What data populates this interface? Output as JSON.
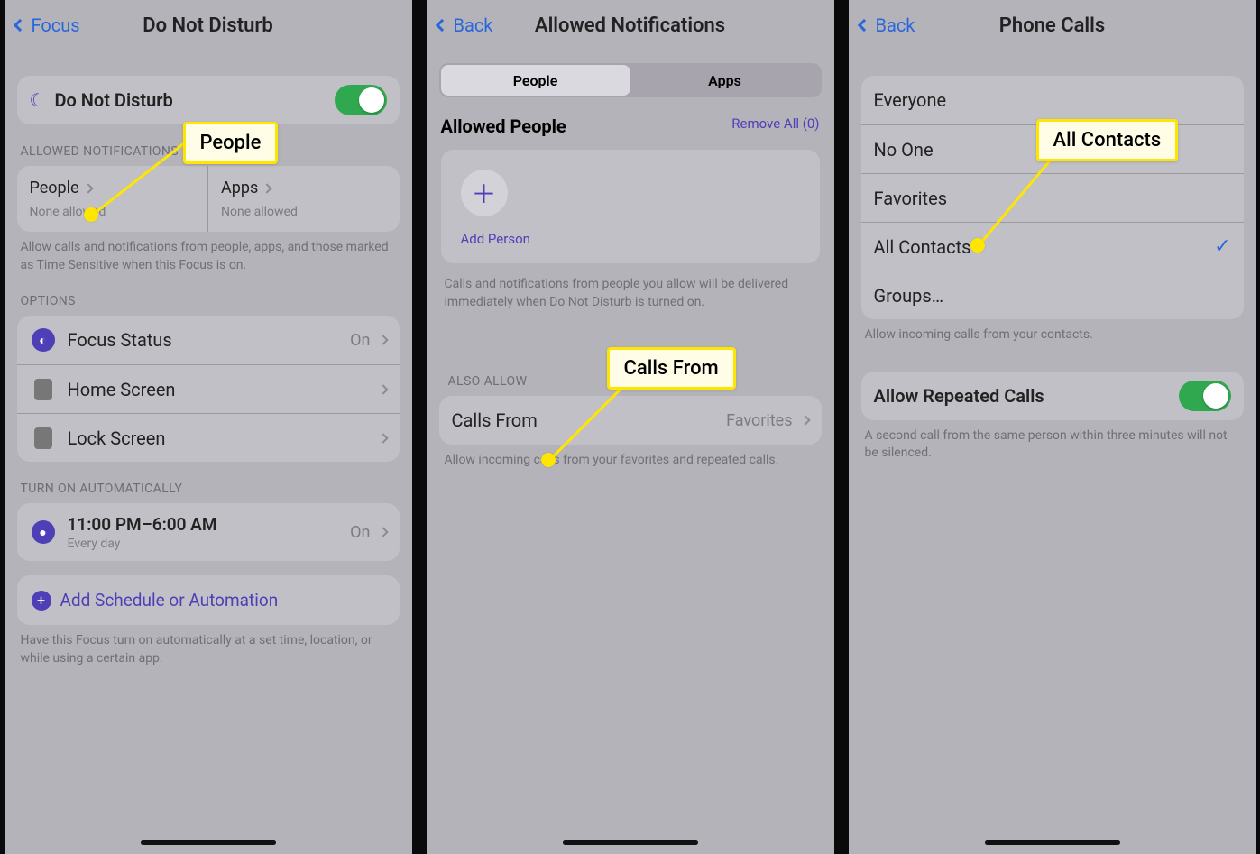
{
  "s1": {
    "back": "Focus",
    "title": "Do Not Disturb",
    "main_label": "Do Not Disturb",
    "allowed_header": "ALLOWED NOTIFICATIONS",
    "people_label": "People",
    "people_value": "None allowed",
    "apps_label": "Apps",
    "apps_value": "None allowed",
    "allowed_footer": "Allow calls and notifications from people, apps, and those marked as Time Sensitive when this Focus is on.",
    "options_header": "OPTIONS",
    "options": [
      {
        "icon": "focus-status-icon",
        "label": "Focus Status",
        "value": "On"
      },
      {
        "icon": "home-screen-icon",
        "label": "Home Screen",
        "value": ""
      },
      {
        "icon": "lock-screen-icon",
        "label": "Lock Screen",
        "value": ""
      }
    ],
    "auto_header": "TURN ON AUTOMATICALLY",
    "schedule_main": "11:00 PM–6:00 AM",
    "schedule_sub": "Every day",
    "schedule_value": "On",
    "add_schedule": "Add Schedule or Automation",
    "auto_footer": "Have this Focus turn on automatically at a set time, location, or while using a certain app.",
    "callout": "People"
  },
  "s2": {
    "back": "Back",
    "title": "Allowed Notifications",
    "segments": [
      "People",
      "Apps"
    ],
    "section": "Allowed People",
    "remove_all": "Remove All (0)",
    "add_person": "Add Person",
    "allowed_footer": "Calls and notifications from people you allow will be delivered immediately when Do Not Disturb is turned on.",
    "also_allow_header": "ALSO ALLOW",
    "calls_from_label": "Calls From",
    "calls_from_value": "Favorites",
    "calls_footer": "Allow incoming calls from your favorites and repeated calls.",
    "callout": "Calls From"
  },
  "s3": {
    "back": "Back",
    "title": "Phone Calls",
    "options": [
      "Everyone",
      "No One",
      "Favorites",
      "All Contacts",
      "Groups…"
    ],
    "selected": "All Contacts",
    "list_footer": "Allow incoming calls from your contacts.",
    "repeated_label": "Allow Repeated Calls",
    "repeated_footer": "A second call from the same person within three minutes will not be silenced.",
    "callout": "All Contacts"
  }
}
